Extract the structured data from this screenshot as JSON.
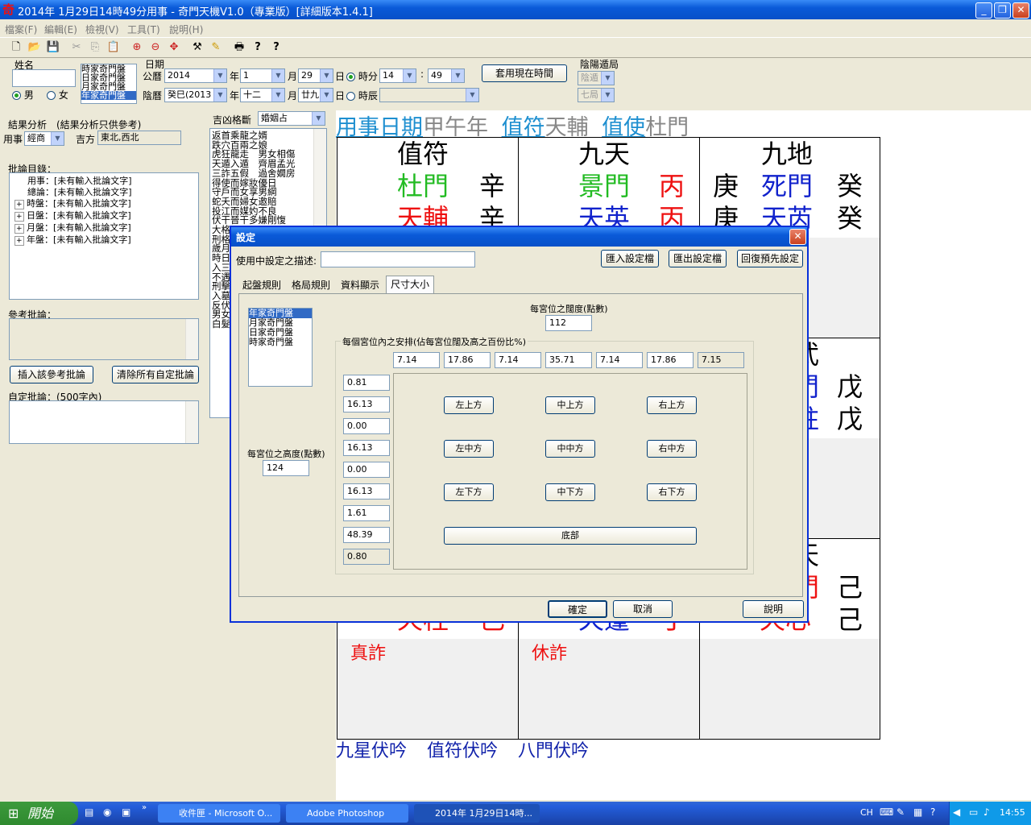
{
  "window": {
    "icon_char": "奇",
    "title": "2014年 1月29日14時49分用事 - 奇門天機V1.0（專業版）[詳細版本1.4.1]",
    "minimize": "_",
    "maximize": "❐",
    "close": "✕"
  },
  "menu": [
    "檔案(F)",
    "編輯(E)",
    "檢視(V)",
    "工具(T)",
    "說明(H)"
  ],
  "toolbar_icons": [
    "new-icon",
    "open-icon",
    "save-icon",
    "cut-icon",
    "copy-icon",
    "paste-icon",
    "zoom-in-icon",
    "zoom-out-icon",
    "target-icon",
    "tool-icon",
    "paint-icon",
    "print-icon",
    "help-icon",
    "context-help-icon"
  ],
  "toolbar_glyphs": [
    "🗋",
    "📂",
    "💾",
    "✂",
    "⎘",
    "📋",
    "⊕",
    "⊖",
    "✥",
    "⚒",
    "✎",
    "🖶",
    "?",
    "?"
  ],
  "form": {
    "name_label": "姓名",
    "gender_male": "男",
    "gender_female": "女",
    "chart_types": [
      "時家奇門盤",
      "日家奇門盤",
      "月家奇門盤",
      "年家奇門盤"
    ],
    "date_label": "日期",
    "solar_label": "公曆",
    "solar_year": "2014",
    "year_unit": "年",
    "solar_month": "1",
    "month_unit": "月",
    "solar_day": "29",
    "day_unit": "日",
    "hour_min_label": "時分",
    "hour": "14",
    "minute": "49",
    "colon": ":",
    "use_now_button": "套用現在時間",
    "lunar_label": "陰曆",
    "lunar_year": "癸巳(2013",
    "lunar_month": "十二",
    "lunar_day": "廿九",
    "shichen_label": "時辰",
    "yinyang_label": "陰陽遁局",
    "yinyang_value": "陰遁",
    "ju_value": "七局"
  },
  "left_panel": {
    "analysis_label": "結果分析　(結果分析只供參考)",
    "yongshi_label": "用事",
    "yongshi_value": "經商",
    "jifang_label": "吉方",
    "jifang_value": "東北,西北",
    "comment_list_label": "批論目錄：",
    "comment_items": [
      "用事：[未有輸入批論文字]",
      "總論：[未有輸入批論文字]",
      "時盤：[未有輸入批論文字]",
      "日盤：[未有輸入批論文字]",
      "月盤：[未有輸入批論文字]",
      "年盤：[未有輸入批論文字]"
    ],
    "reference_label": "參考批論：",
    "insert_button": "插入該參考批論",
    "clear_button": "清除所有自定批論",
    "custom_label": "自定批論：(500字內)"
  },
  "middle_panel": {
    "pattern_label": "吉凶格斷",
    "pattern_value": "婚姻占",
    "lines": [
      "返首乘龍之婿",
      "跌穴百兩之娘",
      "虎狂龍走　男女相傷",
      "天遁入遁　齊眉孟光",
      "三詐五假　過舍嫺房",
      "得使而嫁妝優日",
      "守戶而女享男綱",
      "蛇夭而婦女邀賠",
      "投江而媒妁不良",
      "伏干晉干多嫌剛愎",
      "大格",
      "刑格",
      "歲月",
      "時日",
      "入三",
      "不遇",
      "刑擊",
      "入墓",
      "反伏",
      "男女",
      "白髮"
    ]
  },
  "chart": {
    "header": {
      "yongshi": "用事日期",
      "gz": "甲午年",
      "zhifu": "值符",
      "zhifu_star": "天輔",
      "zhishi": "值使",
      "zhishi_door": "杜門"
    },
    "cells": [
      {
        "deity": "值符",
        "door": "杜門",
        "door_color": "#22bb22",
        "stem1": "辛",
        "stem1_color": "#000000",
        "star": "天輔",
        "star_color": "#ee1111",
        "stem2": "辛",
        "stem2_color": "#000000"
      },
      {
        "deity": "九天",
        "door": "景門",
        "door_color": "#22bb22",
        "stem1": "丙",
        "stem1_color": "#ee1111",
        "star": "天英",
        "star_color": "#1122cc",
        "stem2": "丙",
        "stem2_color": "#ee1111"
      },
      {
        "deity": "九地",
        "left1": "庚",
        "door": "死門",
        "door_color": "#1122cc",
        "stem1": "癸",
        "stem1_color": "#000000",
        "left2": "庚",
        "star": "天芮",
        "star_color": "#1122cc",
        "stem2": "癸",
        "stem2_color": "#000000"
      }
    ],
    "right_mid": {
      "top": "武",
      "door_frag": "門",
      "stem1": "戊",
      "star_frag": "柱",
      "stem2": "戊"
    },
    "bottom": {
      "left_star": "天柱",
      "left_stem": "己",
      "left_note": "真詐",
      "mid_star": "天蓬",
      "mid_stem": "丁",
      "mid_note": "休詐",
      "right_top": "天",
      "right_door": "門",
      "right_stem1": "己",
      "right_star": "天心",
      "right_stem2": "己"
    },
    "footer": [
      "九星伏吟",
      "值符伏吟",
      "八門伏吟"
    ]
  },
  "dialog": {
    "title": "設定",
    "desc_label": "使用中設定之描述:",
    "desc_value": "",
    "import_button": "匯入設定檔",
    "export_button": "匯出設定檔",
    "restore_button": "回復預先設定",
    "tabs": [
      "起盤規則",
      "格局規則",
      "資料顯示",
      "尺寸大小"
    ],
    "chart_list": [
      "年家奇門盤",
      "月家奇門盤",
      "日家奇門盤",
      "時家奇門盤"
    ],
    "width_label": "每宮位之闊度(點數)",
    "width_value": "112",
    "height_label": "每宮位之高度(點數)",
    "height_value": "124",
    "arrange_label": "每個宮位內之安排(佔每宮位闊及高之百份比%)",
    "col_values": [
      "7.14",
      "17.86",
      "7.14",
      "35.71",
      "7.14",
      "17.86",
      "7.15"
    ],
    "row_values": [
      "0.81",
      "16.13",
      "0.00",
      "16.13",
      "0.00",
      "16.13",
      "1.61",
      "48.39",
      "0.80"
    ],
    "pos_buttons": [
      "左上方",
      "中上方",
      "右上方",
      "左中方",
      "中中方",
      "右中方",
      "左下方",
      "中下方",
      "右下方"
    ],
    "bottom_button": "底部",
    "ok": "確定",
    "cancel": "取消",
    "help": "說明"
  },
  "taskbar": {
    "start": "開始",
    "tasks": [
      "收件匣 - Microsoft O...",
      "Adobe Photoshop",
      "2014年 1月29日14時..."
    ],
    "lang": "CH",
    "time": "14:55"
  }
}
